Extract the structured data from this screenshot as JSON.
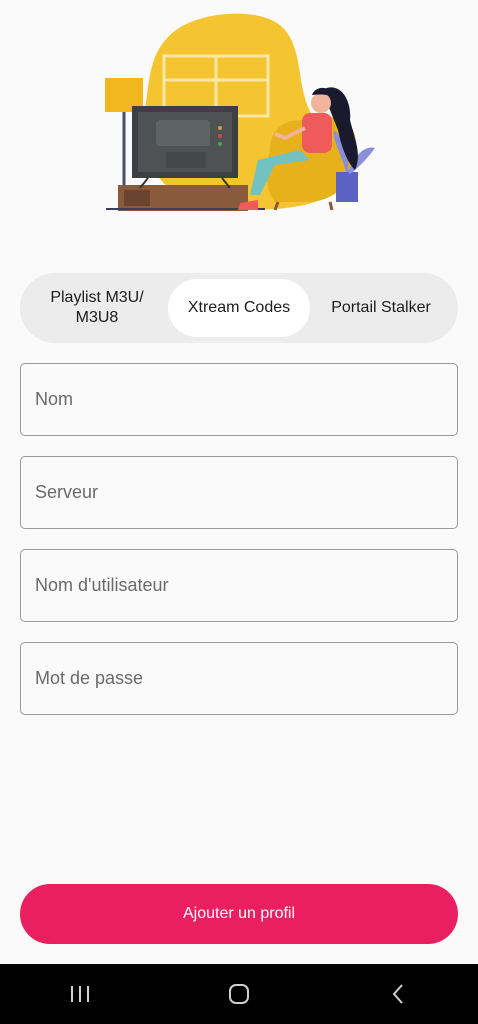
{
  "tabs": [
    {
      "label": "Playlist M3U/\nM3U8",
      "active": false
    },
    {
      "label": "Xtream Codes",
      "active": true
    },
    {
      "label": "Portail Stalker",
      "active": false
    }
  ],
  "form": {
    "name_placeholder": "Nom",
    "server_placeholder": "Serveur",
    "username_placeholder": "Nom d'utilisateur",
    "password_placeholder": "Mot de passe"
  },
  "submit_label": "Ajouter un profil",
  "colors": {
    "accent": "#ea1f61",
    "segment_bg": "#ececec",
    "illustration_yellow": "#f5c531"
  },
  "icons": {
    "nav_recents": "recents-icon",
    "nav_home": "home-icon",
    "nav_back": "back-icon"
  }
}
